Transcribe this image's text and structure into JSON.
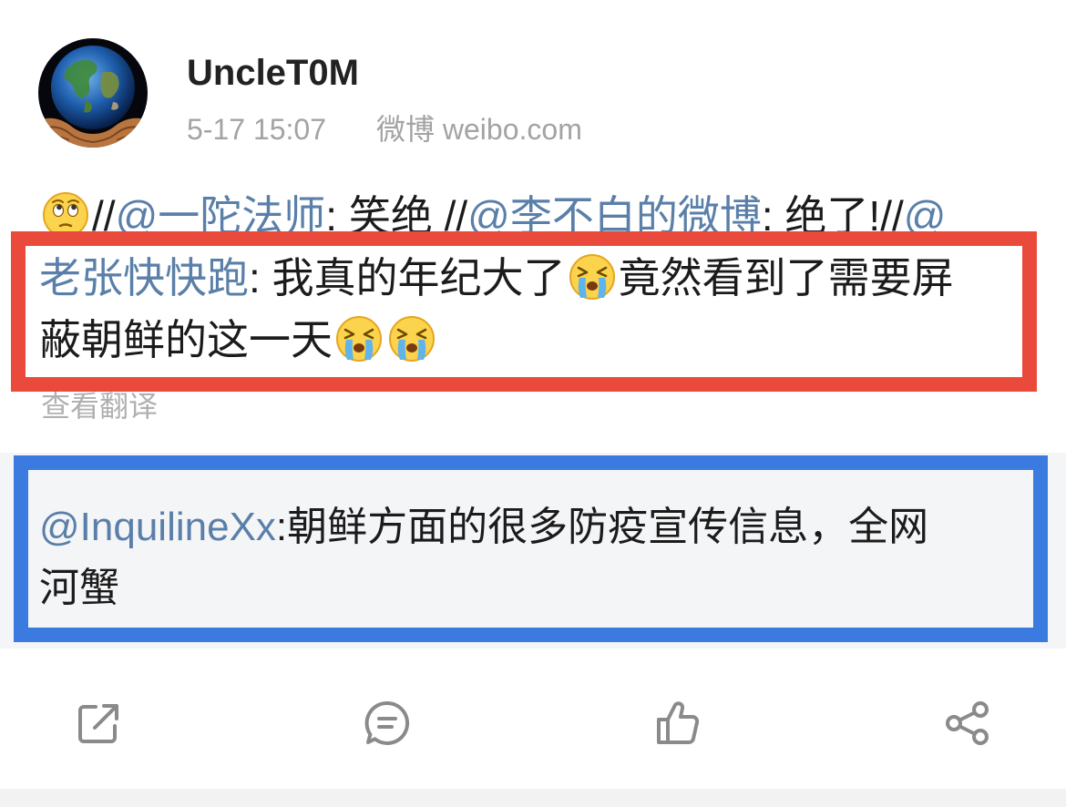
{
  "user": {
    "name": "UncleT0M",
    "avatar": "earth-in-hands-avatar"
  },
  "post": {
    "time": "5-17 15:07",
    "source": "微博 weibo.com",
    "content": [
      [
        {
          "emoji": "thinking-face"
        },
        {
          "text": "//"
        },
        {
          "link": "@一陀法师"
        },
        {
          "text": ": 笑绝 //"
        },
        {
          "link": "@李不白的微博"
        },
        {
          "text": ": 绝了!//"
        },
        {
          "link": "@"
        }
      ],
      [
        {
          "link": "老张快快跑"
        },
        {
          "text": ": 我真的年纪大了"
        },
        {
          "emoji": "crying-face"
        },
        {
          "text": "竟然看到了需要屏"
        }
      ],
      [
        {
          "text": "蔽朝鲜的这一天"
        },
        {
          "emoji": "crying-face"
        },
        {
          "emoji": "crying-face"
        }
      ]
    ],
    "translate_label": "查看翻译"
  },
  "retweet": {
    "content": [
      [
        {
          "link": "@InquilineXx"
        },
        {
          "text": ":朝鲜方面的很多防疫宣传信息，全网"
        }
      ],
      [
        {
          "text": "河蟹"
        }
      ]
    ]
  },
  "actions": [
    {
      "icon": "repost-icon"
    },
    {
      "icon": "comment-icon"
    },
    {
      "icon": "like-icon"
    },
    {
      "icon": "share-icon"
    }
  ],
  "colors": {
    "text": "#1b1b1b",
    "link": "#5a7fa9",
    "meta": "#a3a3a3",
    "icon": "#8a8a8a",
    "retweet_background": "#f4f5f7",
    "highlight_red": "#ea4a3c",
    "highlight_blue": "#3b7be0"
  }
}
